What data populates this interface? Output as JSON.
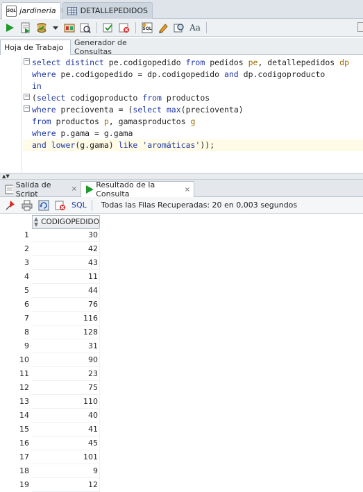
{
  "document_tabs": [
    {
      "label": "jardineria",
      "icon": "sql-worksheet-icon",
      "close": "×"
    },
    {
      "label": "DETALLEPEDIDOS",
      "icon": "table-icon",
      "close": "×"
    }
  ],
  "toolbar": {
    "buttons": [
      "run-statement",
      "run-script",
      "commit",
      "rollback-dropdown",
      "autotrace",
      "explain-plan",
      "sql-tuning",
      "clear",
      "sql-history",
      "format",
      "find",
      "uppercase-toggle"
    ],
    "case_toggle_label": "Aa"
  },
  "editor_tabs": {
    "worksheet": "Hoja de Trabajo",
    "query_builder": "Generador de Consultas"
  },
  "sql_lines": [
    [
      {
        "t": "select distinct ",
        "c": "kw"
      },
      {
        "t": "pe.codigopedido ",
        "c": ""
      },
      {
        "t": "from ",
        "c": "kw"
      },
      {
        "t": "pedidos ",
        "c": ""
      },
      {
        "t": "pe",
        "c": "al"
      },
      {
        "t": ", detallepedidos ",
        "c": ""
      },
      {
        "t": "dp",
        "c": "al"
      }
    ],
    [
      {
        "t": "where ",
        "c": "kw"
      },
      {
        "t": "pe.codigopedido = dp.codigopedido ",
        "c": ""
      },
      {
        "t": "and ",
        "c": "kw"
      },
      {
        "t": "dp.codigoproducto",
        "c": ""
      }
    ],
    [
      {
        "t": "in",
        "c": "kw"
      }
    ],
    [
      {
        "t": "(",
        "c": ""
      },
      {
        "t": "select ",
        "c": "kw"
      },
      {
        "t": "codigoproducto ",
        "c": ""
      },
      {
        "t": "from ",
        "c": "kw"
      },
      {
        "t": "productos",
        "c": ""
      }
    ],
    [
      {
        "t": "where ",
        "c": "kw"
      },
      {
        "t": "precioventa = (",
        "c": ""
      },
      {
        "t": "select ",
        "c": "kw"
      },
      {
        "t": "max",
        "c": "kw"
      },
      {
        "t": "(precioventa)",
        "c": ""
      }
    ],
    [
      {
        "t": "from ",
        "c": "kw"
      },
      {
        "t": "productos ",
        "c": ""
      },
      {
        "t": "p",
        "c": "al"
      },
      {
        "t": ", gamasproductos ",
        "c": ""
      },
      {
        "t": "g",
        "c": "al"
      }
    ],
    [
      {
        "t": "where ",
        "c": "kw"
      },
      {
        "t": "p.gama = g.gama",
        "c": ""
      }
    ],
    [
      {
        "t": "and ",
        "c": "kw"
      },
      {
        "t": "lower",
        "c": "kw"
      },
      {
        "t": "(g.gama) ",
        "c": ""
      },
      {
        "t": "like ",
        "c": "kw"
      },
      {
        "t": "'aromáticas'",
        "c": "str"
      },
      {
        "t": "));",
        "c": ""
      }
    ]
  ],
  "result_tabs": {
    "script_output": "Salida de Script",
    "query_result": "Resultado de la Consulta",
    "close": "×"
  },
  "result_toolbar": {
    "sql_label": "SQL",
    "status": "Todas las Filas Recuperadas: 20 en 0,003 segundos"
  },
  "grid": {
    "column": "CODIGOPEDIDO",
    "rows": [
      {
        "n": "1",
        "v": "30"
      },
      {
        "n": "2",
        "v": "42"
      },
      {
        "n": "3",
        "v": "43"
      },
      {
        "n": "4",
        "v": "11"
      },
      {
        "n": "5",
        "v": "44"
      },
      {
        "n": "6",
        "v": "76"
      },
      {
        "n": "7",
        "v": "116"
      },
      {
        "n": "8",
        "v": "128"
      },
      {
        "n": "9",
        "v": "31"
      },
      {
        "n": "10",
        "v": "90"
      },
      {
        "n": "11",
        "v": "23"
      },
      {
        "n": "12",
        "v": "75"
      },
      {
        "n": "13",
        "v": "110"
      },
      {
        "n": "14",
        "v": "40"
      },
      {
        "n": "15",
        "v": "41"
      },
      {
        "n": "16",
        "v": "45"
      },
      {
        "n": "17",
        "v": "101"
      },
      {
        "n": "18",
        "v": "9"
      },
      {
        "n": "19",
        "v": "12"
      }
    ]
  },
  "colors": {
    "keyword": "#1e38a6",
    "alias": "#a06a00",
    "current_line": "#fffbe6",
    "run_green": "#1f9a2e"
  }
}
